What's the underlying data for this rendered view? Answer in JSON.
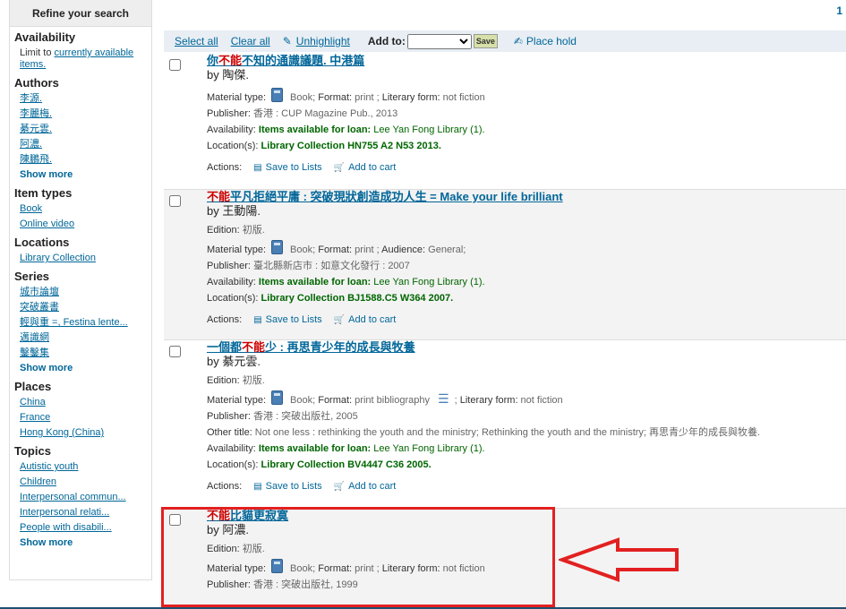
{
  "sidebar": {
    "header": "Refine your search",
    "availability": {
      "heading": "Availability",
      "text": "Limit to ",
      "link1": "currently available",
      "link2": "items."
    },
    "authors": {
      "heading": "Authors",
      "items": [
        "李源.",
        "李麗梅.",
        "綦元雲.",
        "阿濃.",
        "陳鵬飛."
      ],
      "show_more": "Show more"
    },
    "item_types": {
      "heading": "Item types",
      "items": [
        "Book",
        "Online video"
      ]
    },
    "locations": {
      "heading": "Locations",
      "items": [
        "Library Collection"
      ]
    },
    "series": {
      "heading": "Series",
      "items": [
        "城市論壇",
        "突破叢書",
        "輕與重 =, Festina lente...",
        "邁識網",
        "鑿鑿集"
      ],
      "show_more": "Show more"
    },
    "places": {
      "heading": "Places",
      "items": [
        "China",
        "France",
        "Hong Kong (China)"
      ]
    },
    "topics": {
      "heading": "Topics",
      "items": [
        "Autistic youth",
        "Children",
        "Interpersonal commun...",
        "Interpersonal relati...",
        "People with disabili..."
      ],
      "show_more": "Show more"
    }
  },
  "page_number": "1",
  "toolbar": {
    "select_all": "Select all",
    "clear_all": "Clear all",
    "unhighlight": "Unhighlight",
    "add_to": "Add to:",
    "save": "Save",
    "place_hold": "Place hold"
  },
  "results": [
    {
      "title_hl": "不能",
      "title_pre": "你",
      "title_post": "不知的通識議題. 中港篇",
      "author": "by 陶傑.",
      "edition": null,
      "material_label": "Material type:",
      "material_text": "Book; ",
      "format_label": "Format:",
      "format_text": " print ; ",
      "extra_label": "Literary form:",
      "extra_text": " not fiction",
      "publisher_label": "Publisher:",
      "publisher": " 香港 : CUP Magazine Pub., 2013",
      "other_title": null,
      "availability_label": "Availability:",
      "availability_green": " Items available for loan:",
      "availability_text": " Lee Yan Fong Library (1).",
      "location_label": "Location(s):",
      "location_text": " Library Collection HN755 A2 N53 2013.",
      "actions_label": "Actions:",
      "save_to_lists": "Save to Lists",
      "add_to_cart": "Add to cart"
    },
    {
      "title_hl": "不能",
      "title_pre": "",
      "title_post": "平凡拒絕平庸 : 突破現狀創造成功人生 = Make your life brilliant",
      "author": "by 王動陽.",
      "edition": "初版.",
      "material_label": "Material type:",
      "material_text": "Book; ",
      "format_label": "Format:",
      "format_text": " print ; ",
      "extra_label": "Audience:",
      "extra_text": " General;",
      "publisher_label": "Publisher:",
      "publisher": " 臺北縣新店市 : 如意文化發行 : 2007",
      "other_title": null,
      "availability_label": "Availability:",
      "availability_green": " Items available for loan:",
      "availability_text": " Lee Yan Fong Library (1).",
      "location_label": "Location(s):",
      "location_text": " Library Collection BJ1588.C5 W364 2007.",
      "actions_label": "Actions:",
      "save_to_lists": "Save to Lists",
      "add_to_cart": "Add to cart"
    },
    {
      "title_hl": "不能",
      "title_pre": "一個都",
      "title_post": "少 : 再思青少年的成長與牧養",
      "author": "by 綦元雲.",
      "edition": "初版.",
      "material_label": "Material type:",
      "material_text": "Book; ",
      "format_label": "Format:",
      "format_text": " print bibliography ",
      "extra_label": "Literary form:",
      "extra_text": " not fiction",
      "publisher_label": "Publisher:",
      "publisher": " 香港 : 突破出版社, 2005",
      "other_title_label": "Other title:",
      "other_title": " Not one less : rethinking the youth and the ministry; Rethinking the youth and the ministry; 再思青少年的成長與牧養.",
      "availability_label": "Availability:",
      "availability_green": " Items available for loan:",
      "availability_text": " Lee Yan Fong Library (1).",
      "location_label": "Location(s):",
      "location_text": " Library Collection BV4447 C36 2005.",
      "actions_label": "Actions:",
      "save_to_lists": "Save to Lists",
      "add_to_cart": "Add to cart"
    },
    {
      "title_hl": "不能",
      "title_pre": "",
      "title_post": "比貓更寂寞",
      "author": "by 阿濃.",
      "edition": "初版.",
      "material_label": "Material type:",
      "material_text": "Book; ",
      "format_label": "Format:",
      "format_text": " print ; ",
      "extra_label": "Literary form:",
      "extra_text": " not fiction",
      "publisher_label": "Publisher:",
      "publisher": " 香港 : 突破出版社, 1999"
    }
  ],
  "labels": {
    "edition": "Edition:"
  },
  "colors": {
    "highlight_box": "#e32020",
    "link": "#006699",
    "available": "#006600",
    "title_highlight": "#cc0000"
  }
}
